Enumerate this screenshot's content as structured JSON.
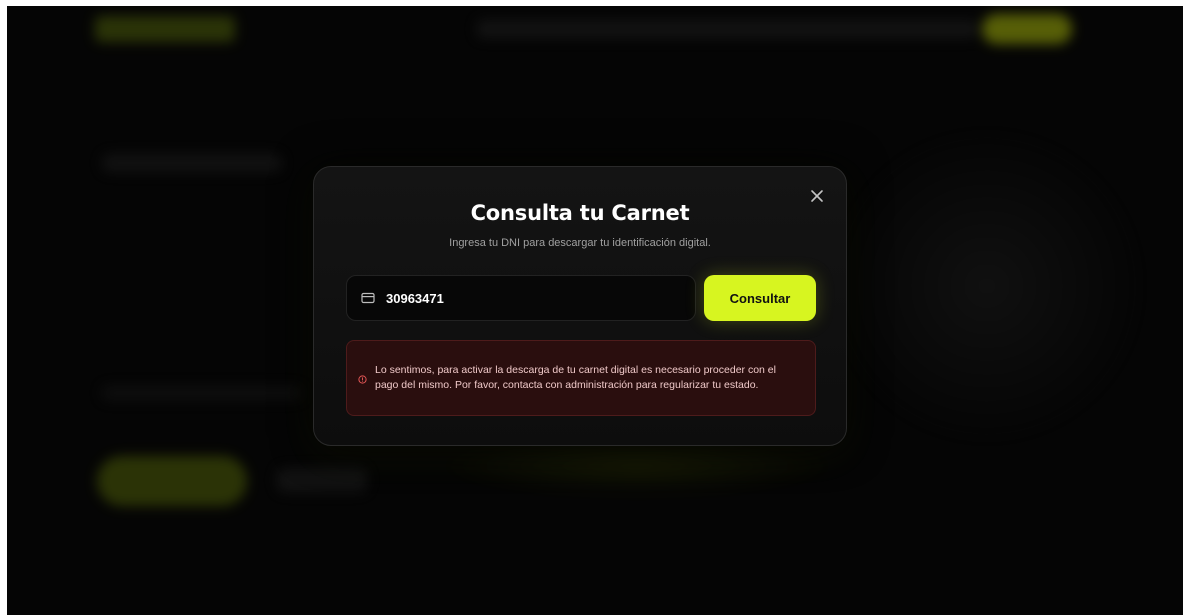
{
  "modal": {
    "title": "Consulta tu Carnet",
    "subtitle": "Ingresa tu DNI para descargar tu identificación digital.",
    "close_icon": "close-icon",
    "dni_input": {
      "value": "30963471",
      "icon": "credit-card-icon"
    },
    "submit_label": "Consultar",
    "error": {
      "icon": "alert-circle-icon",
      "message": "Lo sentimos, para activar la descarga de tu carnet digital es necesario proceder con el pago del mismo. Por favor, contacta con administración para regularizar tu estado."
    }
  },
  "colors": {
    "accent": "#d7f520",
    "error_bg": "#2a0e0e",
    "error_border": "#4e1b1b",
    "error_text": "#f0c9c9",
    "modal_bg": "#121212"
  }
}
